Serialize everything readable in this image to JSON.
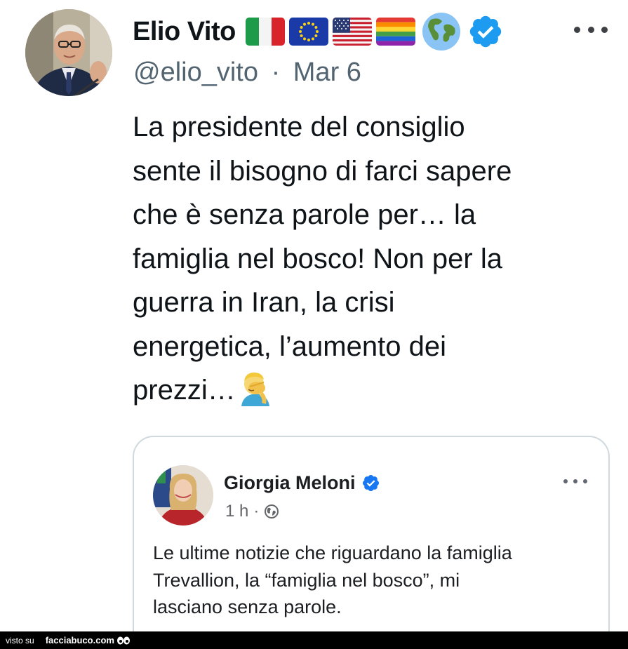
{
  "tweet": {
    "author": {
      "display_name": "Elio Vito",
      "handle": "@elio_vito",
      "badges": [
        "flag-italy-icon",
        "flag-eu-icon",
        "flag-usa-icon",
        "flag-rainbow-icon",
        "globe-icon",
        "verified-icon"
      ]
    },
    "separator": "·",
    "date": "Mar 6",
    "text_lines": [
      "La presidente del consiglio",
      "sente il bisogno di farci sapere",
      "che è senza parole per… la",
      "famiglia nel bosco! Non per la",
      "guerra in Iran, la crisi",
      "energetica, l’aumento dei",
      "prezzi…"
    ],
    "emoji": "facepalm-icon",
    "more_icon": "more-icon"
  },
  "quote": {
    "author": {
      "display_name": "Giorgia Meloni",
      "badge": "verified-icon"
    },
    "time": "1 h",
    "separator": "·",
    "privacy_icon": "globe-icon",
    "text_lines": [
      "Le ultime notizie che riguardano la famiglia",
      "Trevallion, la “famiglia nel bosco”, mi",
      "lasciano senza parole."
    ],
    "more_icon": "more-icon"
  },
  "watermark": {
    "prefix": "visto su",
    "site": "facciabuco.com",
    "icon": "eyes-icon"
  },
  "colors": {
    "text": "#0f1419",
    "secondary": "#536471",
    "verified": "#1d9bf0",
    "fb_verified": "#1877f2",
    "card_border": "#cfd9de",
    "watermark_bg": "#000000"
  }
}
